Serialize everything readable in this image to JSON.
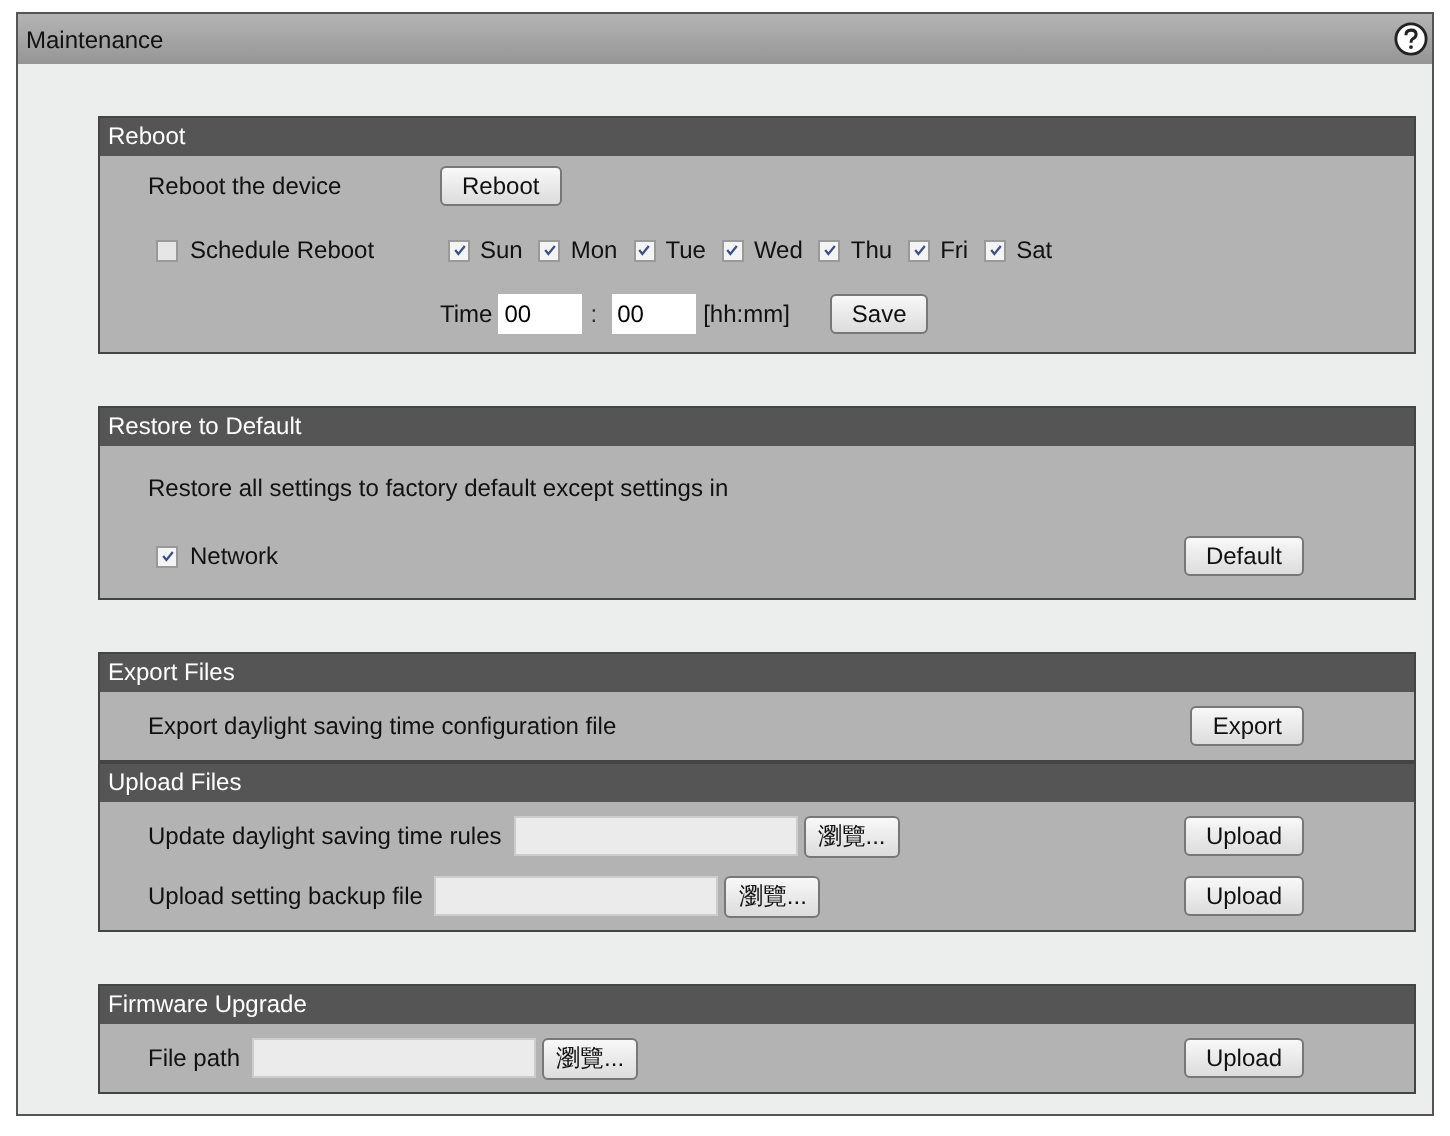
{
  "window": {
    "title": "Maintenance"
  },
  "reboot": {
    "title": "Reboot",
    "label": "Reboot the device",
    "button": "Reboot",
    "schedule": {
      "label": "Schedule Reboot",
      "checked": false
    },
    "days": [
      {
        "label": "Sun",
        "checked": true
      },
      {
        "label": "Mon",
        "checked": true
      },
      {
        "label": "Tue",
        "checked": true
      },
      {
        "label": "Wed",
        "checked": true
      },
      {
        "label": "Thu",
        "checked": true
      },
      {
        "label": "Fri",
        "checked": true
      },
      {
        "label": "Sat",
        "checked": true
      }
    ],
    "time_label": "Time",
    "hour": "00",
    "separator": ":",
    "minute": "00",
    "format": "[hh:mm]",
    "save": "Save"
  },
  "restore": {
    "title": "Restore to Default",
    "text": "Restore all settings to factory default except settings in",
    "network": {
      "label": "Network",
      "checked": true
    },
    "button": "Default"
  },
  "export": {
    "title": "Export Files",
    "text": "Export daylight saving time configuration file",
    "button": "Export"
  },
  "upload": {
    "title": "Upload Files",
    "rows": [
      {
        "label": "Update daylight saving time rules",
        "browse": "瀏覽...",
        "button": "Upload"
      },
      {
        "label": "Upload setting backup file",
        "browse": "瀏覽...",
        "button": "Upload"
      }
    ]
  },
  "firmware": {
    "title": "Firmware Upgrade",
    "label": "File path",
    "browse": "瀏覽...",
    "button": "Upload"
  }
}
